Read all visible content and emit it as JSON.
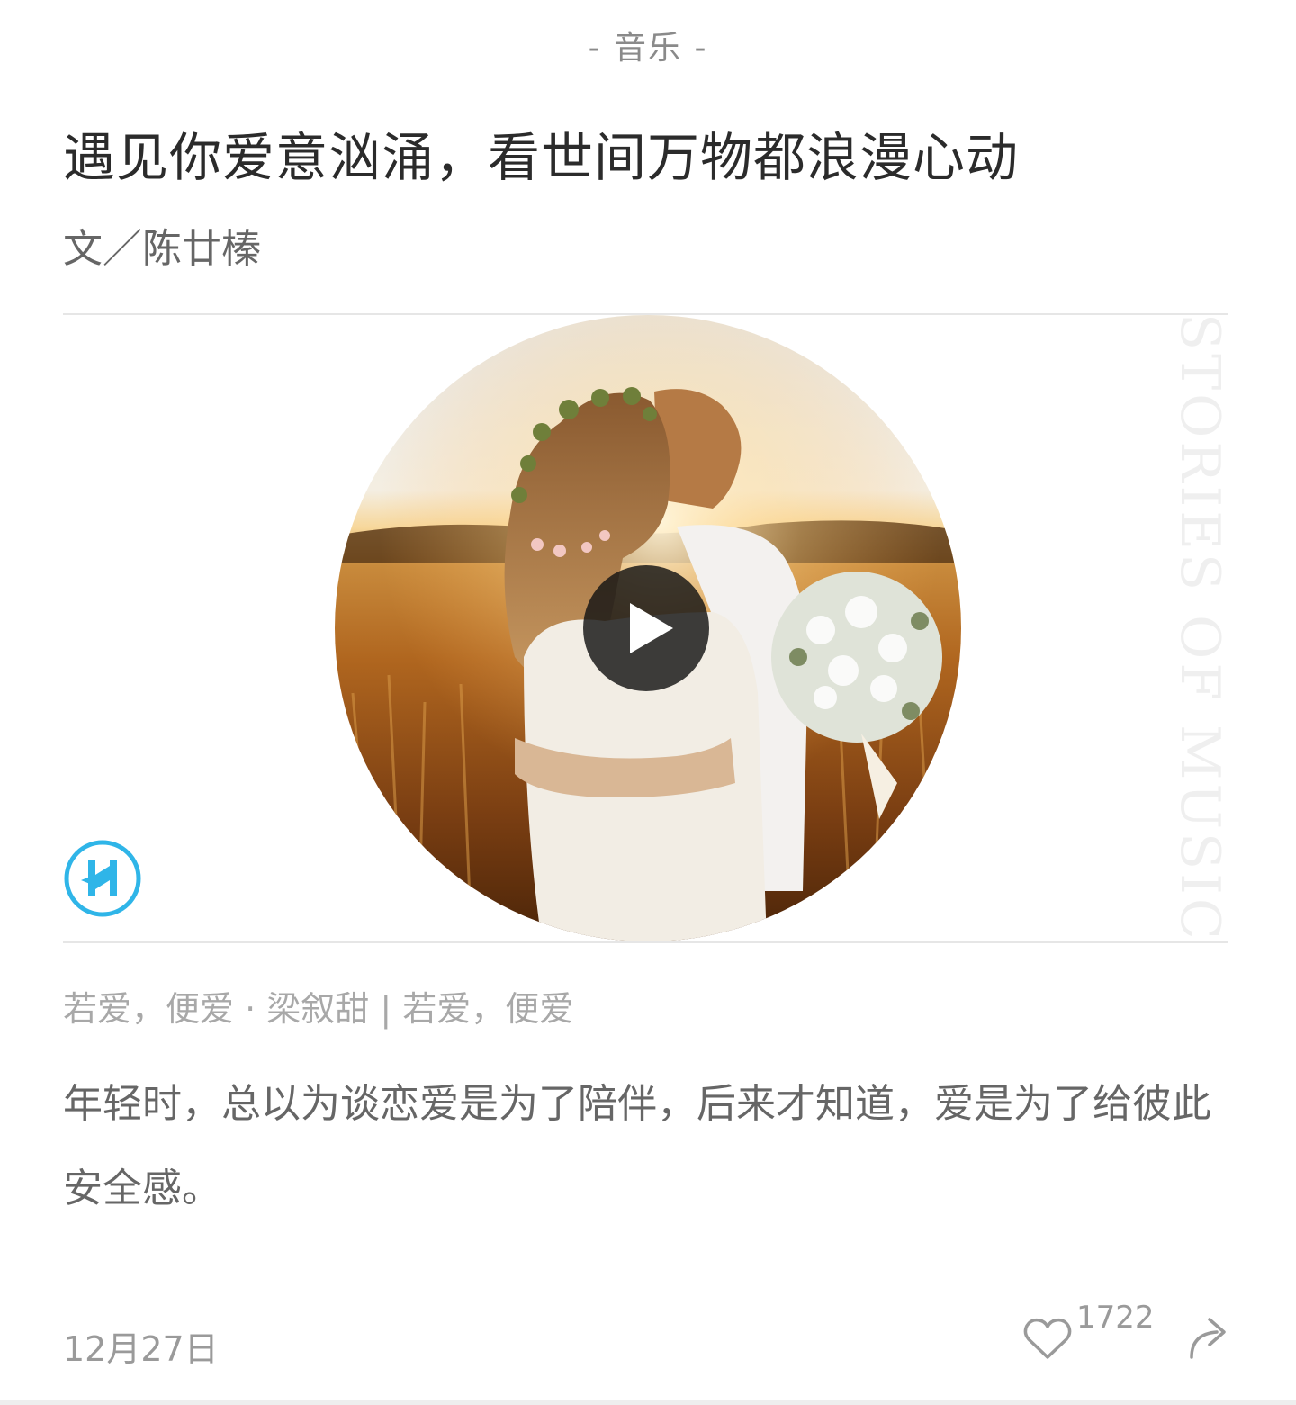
{
  "header": {
    "category": "- 音乐 -"
  },
  "article": {
    "title": "遇见你爱意汹涌，看世间万物都浪漫心动",
    "author": "文／陈廿榛",
    "watermark": "STORIES OF MUSIC"
  },
  "player": {
    "cover_alt": "wedding couple in golden field at sunset",
    "play_icon": "play-icon",
    "logo_icon": "brand-logo-icon"
  },
  "track": {
    "info": "若爱，便爱 · 梁叙甜 | 若爱，便爱"
  },
  "excerpt": {
    "text": "年轻时，总以为谈恋爱是为了陪伴，后来才知道，爱是为了给彼此安全感。"
  },
  "footer": {
    "date": "12月27日",
    "like_count": "1722",
    "like_icon": "heart-icon",
    "share_icon": "share-arrow-icon"
  },
  "colors": {
    "accent_logo": "#2fb5e8",
    "watermark": "#efefef",
    "text_muted": "#9a9a9a"
  }
}
